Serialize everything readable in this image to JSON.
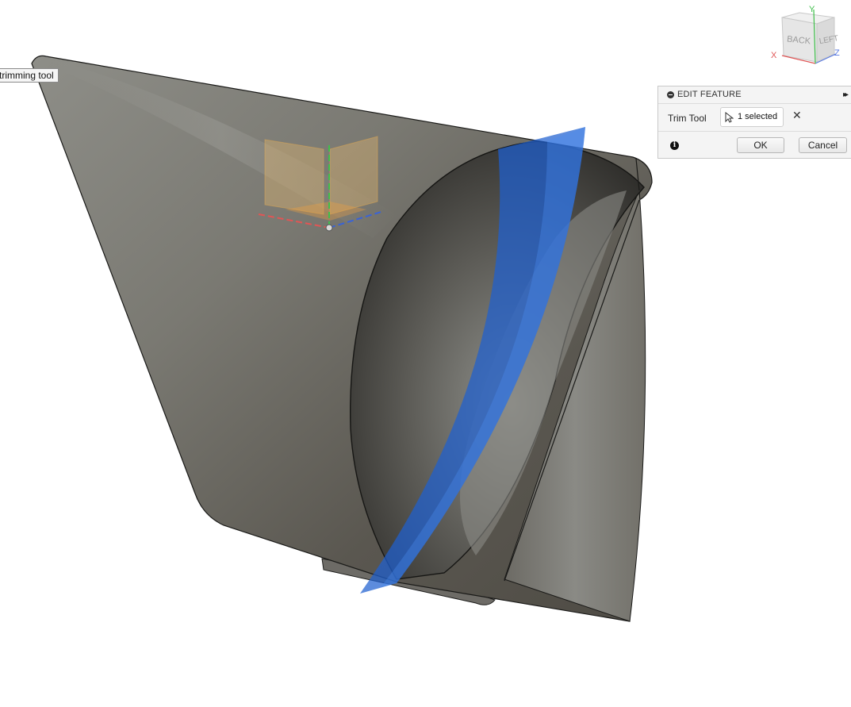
{
  "tooltip": {
    "text": "trimming tool"
  },
  "viewcube": {
    "face_back": "BACK",
    "face_left": "LEFT",
    "axis_x": "X",
    "axis_y": "Y",
    "axis_z": "Z"
  },
  "edit_feature": {
    "title": "EDIT FEATURE",
    "expand_glyph": "▸▸",
    "trim_tool_label": "Trim Tool",
    "selection_value": "1 selected",
    "clear_glyph": "✕",
    "info_glyph": "i",
    "ok_label": "OK",
    "cancel_label": "Cancel"
  },
  "colors": {
    "body_light": "#898983",
    "body_dark": "#55524b",
    "tool_surface": "#1f5fd0",
    "plane_orange": "#f2c070",
    "axis_red": "#e05555",
    "axis_green": "#3fbf4a",
    "axis_blue": "#3a63d6"
  }
}
